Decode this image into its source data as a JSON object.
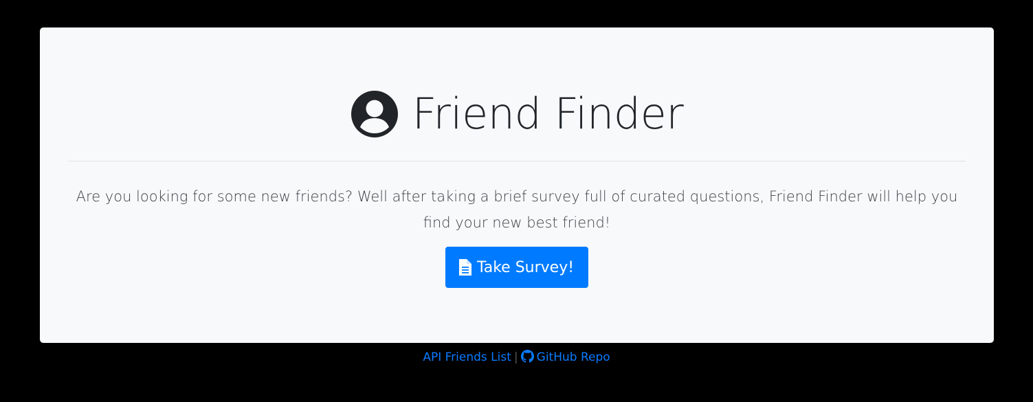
{
  "jumbotron": {
    "title": "Friend Finder",
    "title_icon": "user-circle-icon",
    "lead": "Are you looking for some new friends? Well after taking a brief survey full of curated questions, Friend Finder will help you find your new best friend!",
    "button": {
      "label": "Take Survey!",
      "icon": "file-icon",
      "color": "#007bff"
    }
  },
  "footer": {
    "api_link": "API Friends List",
    "separator": "|",
    "github_link": "GitHub Repo",
    "github_icon": "github-icon",
    "link_color": "#0a7bff"
  },
  "colors": {
    "background": "#000000",
    "panel": "#f8f9fa",
    "text": "#212529"
  }
}
